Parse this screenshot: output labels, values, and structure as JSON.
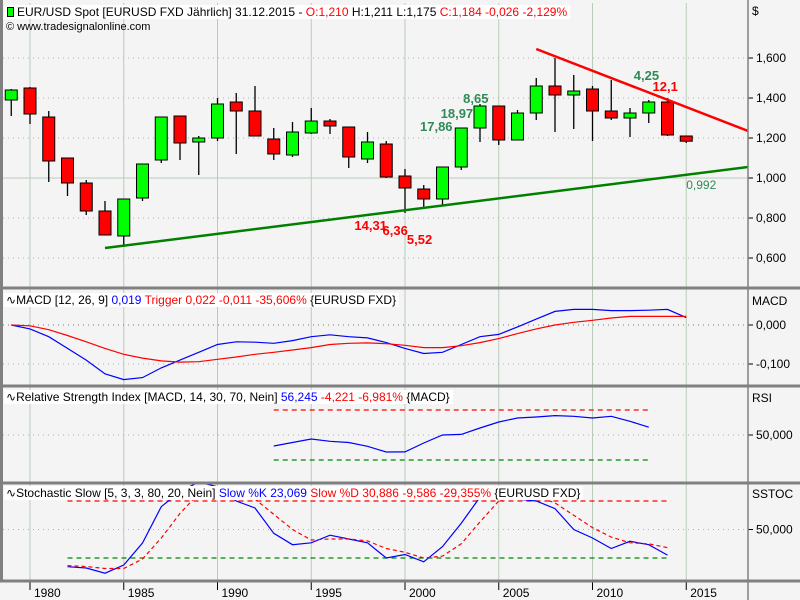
{
  "header": {
    "instrument": "EUR/USD Spot [EURUSD FXD  Jährlich] 31.12.2015 -",
    "open": "O:1,210",
    "high": "H:1,211",
    "low": "L:1,175",
    "close_change": "C:1,184 -0,026 -2,129%",
    "copyright": "© www.tradesignalonline.com",
    "currency": "$"
  },
  "colors": {
    "up": "#00ff00",
    "down": "#ff0000",
    "support": "#008000",
    "resistance": "#ff0000",
    "macd": "#0000ff",
    "trigger": "#ff0000",
    "annot_green": "#2e8b57"
  },
  "chart_data": [
    {
      "type": "candlestick",
      "title": "EUR/USD Spot [EURUSD FXD Jährlich]",
      "ylim": [
        0.5,
        1.75
      ],
      "yticks": [
        "0,600",
        "0,800",
        "1,000",
        "1,200",
        "1,400",
        "1,600"
      ],
      "ytick_values": [
        0.6,
        0.8,
        1.0,
        1.2,
        1.4,
        1.6
      ],
      "xticks": [
        "1980",
        "1985",
        "1990",
        "1995",
        "2000",
        "2005",
        "2010",
        "2015"
      ],
      "xtick_values": [
        1980,
        1985,
        1990,
        1995,
        2000,
        2005,
        2010,
        2015
      ],
      "xlim": [
        1978.4,
        2018.3
      ],
      "candles": [
        [
          1979,
          1.39,
          1.445,
          1.31,
          1.44
        ],
        [
          1980,
          1.45,
          1.455,
          1.27,
          1.32
        ],
        [
          1981,
          1.305,
          1.335,
          0.98,
          1.085
        ],
        [
          1982,
          1.1,
          1.1,
          0.91,
          0.975
        ],
        [
          1983,
          0.975,
          0.99,
          0.815,
          0.835
        ],
        [
          1984,
          0.835,
          0.885,
          0.715,
          0.715
        ],
        [
          1985,
          0.71,
          0.895,
          0.655,
          0.895
        ],
        [
          1986,
          0.9,
          1.07,
          0.885,
          1.07
        ],
        [
          1987,
          1.09,
          1.305,
          1.075,
          1.305
        ],
        [
          1988,
          1.31,
          1.31,
          1.09,
          1.175
        ],
        [
          1989,
          1.18,
          1.21,
          1.015,
          1.2
        ],
        [
          1990,
          1.2,
          1.4,
          1.185,
          1.37
        ],
        [
          1991,
          1.38,
          1.425,
          1.12,
          1.335
        ],
        [
          1992,
          1.335,
          1.46,
          1.21,
          1.21
        ],
        [
          1993,
          1.195,
          1.25,
          1.09,
          1.12
        ],
        [
          1994,
          1.115,
          1.28,
          1.105,
          1.23
        ],
        [
          1995,
          1.225,
          1.35,
          1.22,
          1.285
        ],
        [
          1996,
          1.285,
          1.295,
          1.22,
          1.26
        ],
        [
          1997,
          1.255,
          1.255,
          1.05,
          1.105
        ],
        [
          1998,
          1.095,
          1.23,
          1.075,
          1.18
        ],
        [
          1999,
          1.17,
          1.185,
          1.0,
          1.005
        ],
        [
          2000,
          1.01,
          1.045,
          0.825,
          0.95
        ],
        [
          2001,
          0.945,
          0.965,
          0.85,
          0.895
        ],
        [
          2002,
          0.895,
          1.055,
          0.86,
          1.055
        ],
        [
          2003,
          1.055,
          1.25,
          1.04,
          1.25
        ],
        [
          2004,
          1.25,
          1.37,
          1.18,
          1.36
        ],
        [
          2005,
          1.36,
          1.36,
          1.165,
          1.19
        ],
        [
          2006,
          1.19,
          1.34,
          1.19,
          1.325
        ],
        [
          2007,
          1.325,
          1.5,
          1.29,
          1.46
        ],
        [
          2008,
          1.46,
          1.6,
          1.23,
          1.415
        ],
        [
          2009,
          1.415,
          1.515,
          1.245,
          1.435
        ],
        [
          2010,
          1.445,
          1.46,
          1.185,
          1.335
        ],
        [
          2011,
          1.335,
          1.49,
          1.29,
          1.3
        ],
        [
          2012,
          1.3,
          1.35,
          1.205,
          1.325
        ],
        [
          2013,
          1.325,
          1.39,
          1.275,
          1.38
        ],
        [
          2014,
          1.38,
          1.4,
          1.21,
          1.215
        ],
        [
          2015,
          1.21,
          1.211,
          1.175,
          1.184
        ]
      ],
      "candle_fields": [
        "year",
        "open",
        "high",
        "low",
        "close"
      ],
      "trendlines": [
        {
          "name": "support",
          "from": [
            1984,
            0.65
          ],
          "to": [
            2018.3,
            1.055
          ]
        },
        {
          "name": "resistance",
          "from": [
            2007,
            1.645
          ],
          "to": [
            2018.3,
            1.235
          ]
        }
      ],
      "annotations": [
        {
          "text": "14,31",
          "year": 1997.3,
          "price": 0.74,
          "color": "red"
        },
        {
          "text": "6,36",
          "year": 1998.8,
          "price": 0.715,
          "color": "red"
        },
        {
          "text": "5,52",
          "year": 2000.1,
          "price": 0.67,
          "color": "red"
        },
        {
          "text": "17,86",
          "year": 2000.8,
          "price": 1.235,
          "color": "green"
        },
        {
          "text": "18,97",
          "year": 2001.9,
          "price": 1.3,
          "color": "green"
        },
        {
          "text": "8,65",
          "year": 2003.1,
          "price": 1.375,
          "color": "green"
        },
        {
          "text": "4,25",
          "year": 2012.2,
          "price": 1.49,
          "color": "green"
        },
        {
          "text": "12,1",
          "year": 2013.2,
          "price": 1.435,
          "color": "red"
        },
        {
          "text": "0,992",
          "year": 2015,
          "price": 0.945,
          "color": "green",
          "plain": true
        }
      ]
    },
    {
      "type": "line",
      "legend": {
        "name": "MACD [12, 26, 9]",
        "macd": "0,019",
        "trigger_label": "Trigger",
        "trigger": "0,022 -0,011 -35,606%",
        "source": "{EURUSD FXD}"
      },
      "axis_label": "MACD",
      "yticks": [
        "0,000",
        "-0,100"
      ],
      "ytick_values": [
        0,
        -0.1
      ],
      "start_year": 1979,
      "series": [
        {
          "name": "MACD",
          "values": [
            0,
            -0.01,
            -0.03,
            -0.06,
            -0.09,
            -0.125,
            -0.14,
            -0.135,
            -0.11,
            -0.09,
            -0.07,
            -0.05,
            -0.043,
            -0.044,
            -0.047,
            -0.04,
            -0.03,
            -0.025,
            -0.03,
            -0.033,
            -0.045,
            -0.06,
            -0.073,
            -0.07,
            -0.05,
            -0.03,
            -0.024,
            -0.005,
            0.015,
            0.035,
            0.04,
            0.04,
            0.037,
            0.037,
            0.038,
            0.04,
            0.019
          ]
        },
        {
          "name": "Trigger",
          "values": [
            0,
            -0.002,
            -0.012,
            -0.027,
            -0.043,
            -0.06,
            -0.075,
            -0.085,
            -0.092,
            -0.095,
            -0.094,
            -0.088,
            -0.082,
            -0.075,
            -0.07,
            -0.064,
            -0.058,
            -0.05,
            -0.047,
            -0.046,
            -0.048,
            -0.052,
            -0.058,
            -0.058,
            -0.053,
            -0.045,
            -0.035,
            -0.022,
            -0.01,
            0.0,
            0.007,
            0.012,
            0.018,
            0.022,
            0.022,
            0.022,
            0.022
          ]
        }
      ]
    },
    {
      "type": "line",
      "legend": {
        "name": "Relative Strength Index [MACD, 14, 30, 70, Nein]",
        "value": "56,245",
        "change": "-4,221 -6,981%",
        "source": "{MACD}"
      },
      "axis_label": "RSI",
      "yticks": [
        "50,000"
      ],
      "ytick_values": [
        50
      ],
      "levels": [
        70,
        30
      ],
      "start_year": 1993,
      "series": [
        {
          "name": "RSI",
          "values": [
            41.2,
            44,
            46.8,
            45,
            44,
            41,
            36.4,
            36.5,
            43.6,
            50,
            50.5,
            55.6,
            60.4,
            63.6,
            64.4,
            65.5,
            65,
            63.6,
            65,
            61,
            56.245
          ]
        }
      ]
    },
    {
      "type": "line",
      "legend": {
        "name": "Stochastic Slow [5, 3, 3, 80, 20, Nein]",
        "k": "Slow %K 23,069",
        "d": "Slow %D 30,886 -9,586 -29,355%",
        "source": "{EURUSD FXD}"
      },
      "axis_label": "SSTOC",
      "yticks": [
        "50,000"
      ],
      "ytick_values": [
        50
      ],
      "levels": [
        80,
        20
      ],
      "start_year": 1982,
      "series": [
        {
          "name": "Slow %K",
          "values": [
            10.8,
            9.5,
            4,
            12.6,
            35.8,
            74,
            90,
            100,
            95,
            80,
            72.6,
            46,
            34,
            36,
            44,
            40,
            36,
            20,
            23.7,
            16,
            32,
            56.6,
            84,
            95,
            82,
            80,
            72,
            50,
            41,
            30,
            37.6,
            34,
            23.069
          ]
        },
        {
          "name": "Slow %D",
          "values": [
            12,
            11,
            9,
            9,
            19,
            41,
            67,
            88,
            95,
            95,
            82,
            66,
            50,
            39,
            40,
            40,
            38,
            30,
            26,
            20,
            22,
            35,
            58,
            80,
            87,
            85,
            78,
            65,
            52,
            42,
            36,
            35,
            30.886
          ]
        }
      ]
    }
  ]
}
